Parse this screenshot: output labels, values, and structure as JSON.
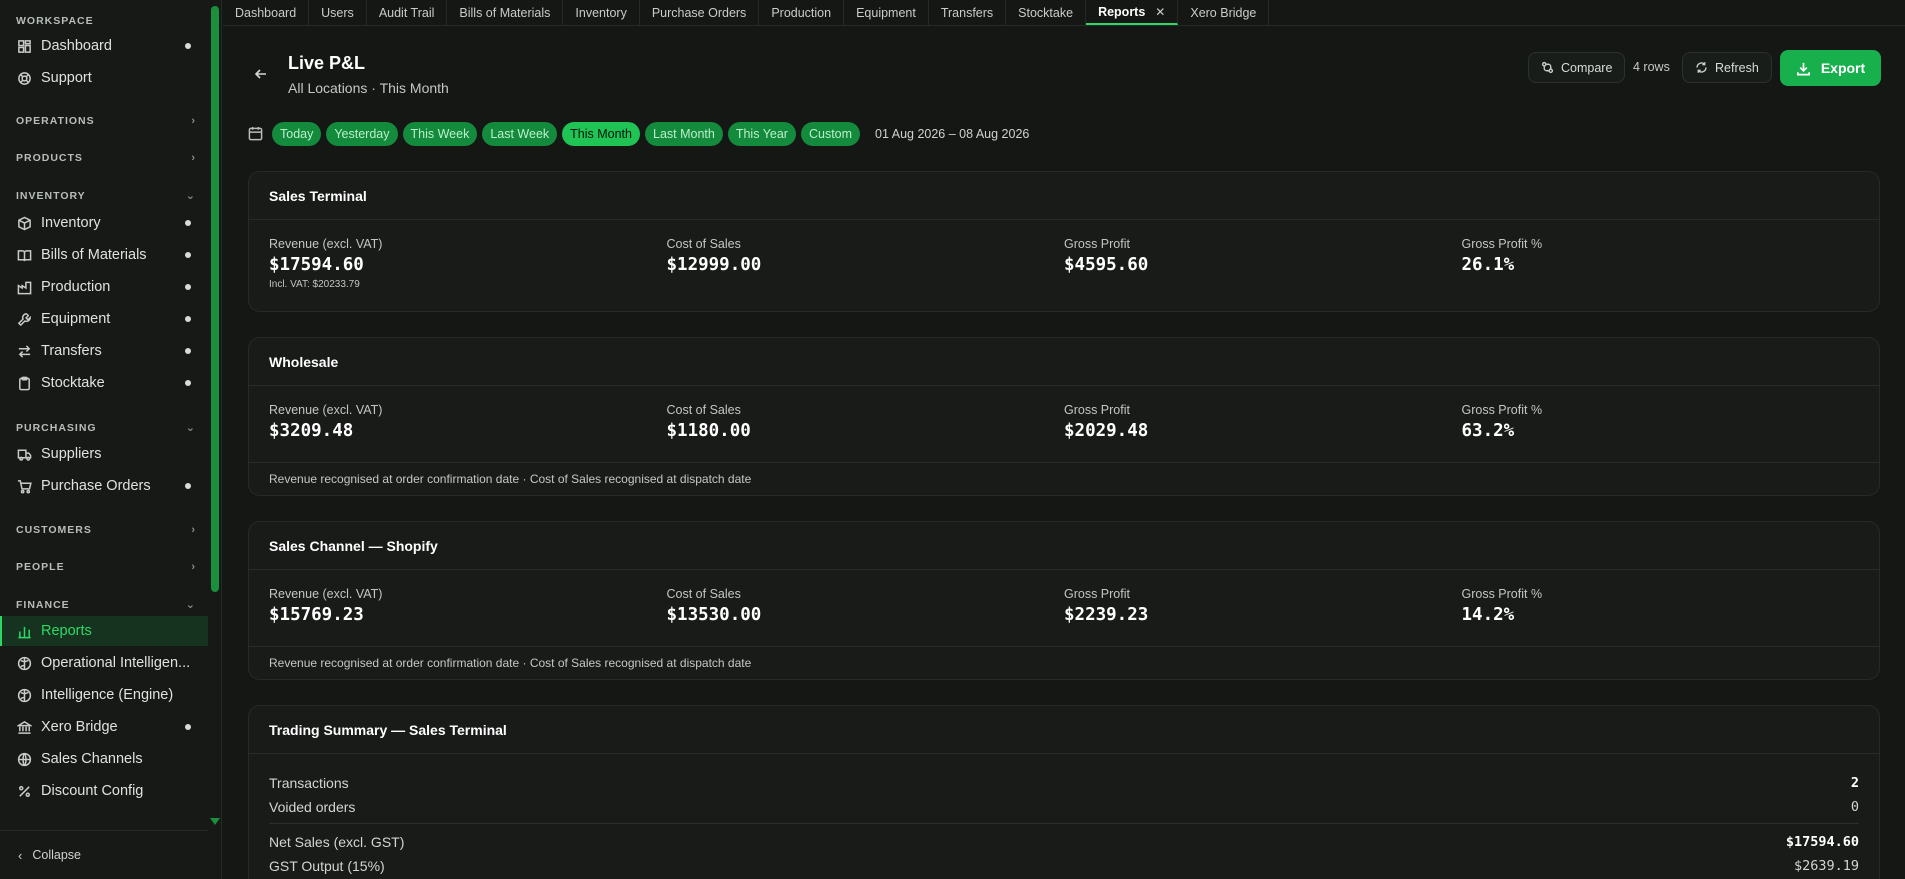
{
  "sidebar": {
    "sections": {
      "workspace": "WORKSPACE",
      "operations": "OPERATIONS",
      "products": "PRODUCTS",
      "inventory": "INVENTORY",
      "purchasing": "PURCHASING",
      "customers": "CUSTOMERS",
      "people": "PEOPLE",
      "finance": "FINANCE"
    },
    "items": {
      "dashboard": "Dashboard",
      "support": "Support",
      "inventory": "Inventory",
      "bom": "Bills of Materials",
      "production": "Production",
      "equipment": "Equipment",
      "transfers": "Transfers",
      "stocktake": "Stocktake",
      "suppliers": "Suppliers",
      "purchase_orders": "Purchase Orders",
      "reports": "Reports",
      "op_intel": "Operational Intelligen...",
      "intel_engine": "Intelligence (Engine)",
      "xero_bridge": "Xero Bridge",
      "sales_channels": "Sales Channels",
      "discount_config": "Discount Config"
    },
    "collapse_label": "Collapse"
  },
  "tabs": [
    "Dashboard",
    "Users",
    "Audit Trail",
    "Bills of Materials",
    "Inventory",
    "Purchase Orders",
    "Production",
    "Equipment",
    "Transfers",
    "Stocktake",
    "Reports",
    "Xero Bridge"
  ],
  "active_tab": "Reports",
  "header": {
    "title": "Live P&L",
    "subtitle": "All Locations · This Month",
    "compare_label": "Compare",
    "rows_label": "4 rows",
    "refresh_label": "Refresh",
    "export_label": "Export"
  },
  "date_filter": {
    "chips": [
      "Today",
      "Yesterday",
      "This Week",
      "Last Week",
      "This Month",
      "Last Month",
      "This Year",
      "Custom"
    ],
    "active": "This Month",
    "range": "01 Aug 2026 – 08 Aug 2026"
  },
  "labels": {
    "revenue": "Revenue (excl. VAT)",
    "cost": "Cost of Sales",
    "gross_profit": "Gross Profit",
    "gross_profit_pct": "Gross Profit %"
  },
  "cards": {
    "sales_terminal": {
      "title": "Sales Terminal",
      "revenue": "$17594.60",
      "revenue_incl": "Incl. VAT: $20233.79",
      "cost": "$12999.00",
      "gross_profit": "$4595.60",
      "gross_profit_pct": "26.1%"
    },
    "wholesale": {
      "title": "Wholesale",
      "revenue": "$3209.48",
      "cost": "$1180.00",
      "gross_profit": "$2029.48",
      "gross_profit_pct": "63.2%",
      "note": "Revenue recognised at order confirmation date · Cost of Sales recognised at dispatch date"
    },
    "shopify": {
      "title": "Sales Channel — Shopify",
      "revenue": "$15769.23",
      "cost": "$13530.00",
      "gross_profit": "$2239.23",
      "gross_profit_pct": "14.2%",
      "note": "Revenue recognised at order confirmation date · Cost of Sales recognised at dispatch date"
    }
  },
  "trading_summary": {
    "title": "Trading Summary — Sales Terminal",
    "transactions_label": "Transactions",
    "transactions": "2",
    "voided_label": "Voided orders",
    "voided": "0",
    "net_sales_label": "Net Sales (excl. GST)",
    "net_sales": "$17594.60",
    "gst_label": "GST Output (15%)",
    "gst": "$2639.19"
  },
  "colors": {
    "accent": "#1fc454",
    "background": "#141714",
    "card": "#181b18"
  }
}
